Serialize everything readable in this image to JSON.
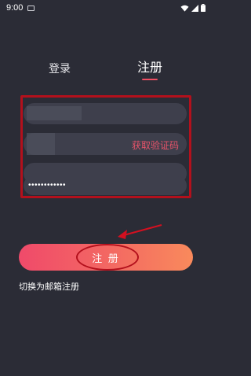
{
  "status_bar": {
    "time": "9:00",
    "icons": [
      "sim-card-icon",
      "wifi-icon",
      "signal-icon",
      "battery-icon"
    ]
  },
  "tabs": [
    {
      "label": "登录",
      "active": false
    },
    {
      "label": "注册",
      "active": true
    }
  ],
  "form": {
    "fields": [
      {
        "name": "field-1",
        "value": ""
      },
      {
        "name": "verification-code-field",
        "value": "",
        "action_label": "获取验证码"
      },
      {
        "name": "field-3",
        "value": ""
      },
      {
        "name": "password-field",
        "value": "••••••••••••"
      }
    ]
  },
  "register_button": {
    "label": "注 册"
  },
  "switch_link": {
    "label": "切换为邮箱注册"
  },
  "colors": {
    "background": "#2b2c36",
    "field_bg": "#3e3f4c",
    "accent": "#ef4f63",
    "annotation": "#b3101c"
  }
}
